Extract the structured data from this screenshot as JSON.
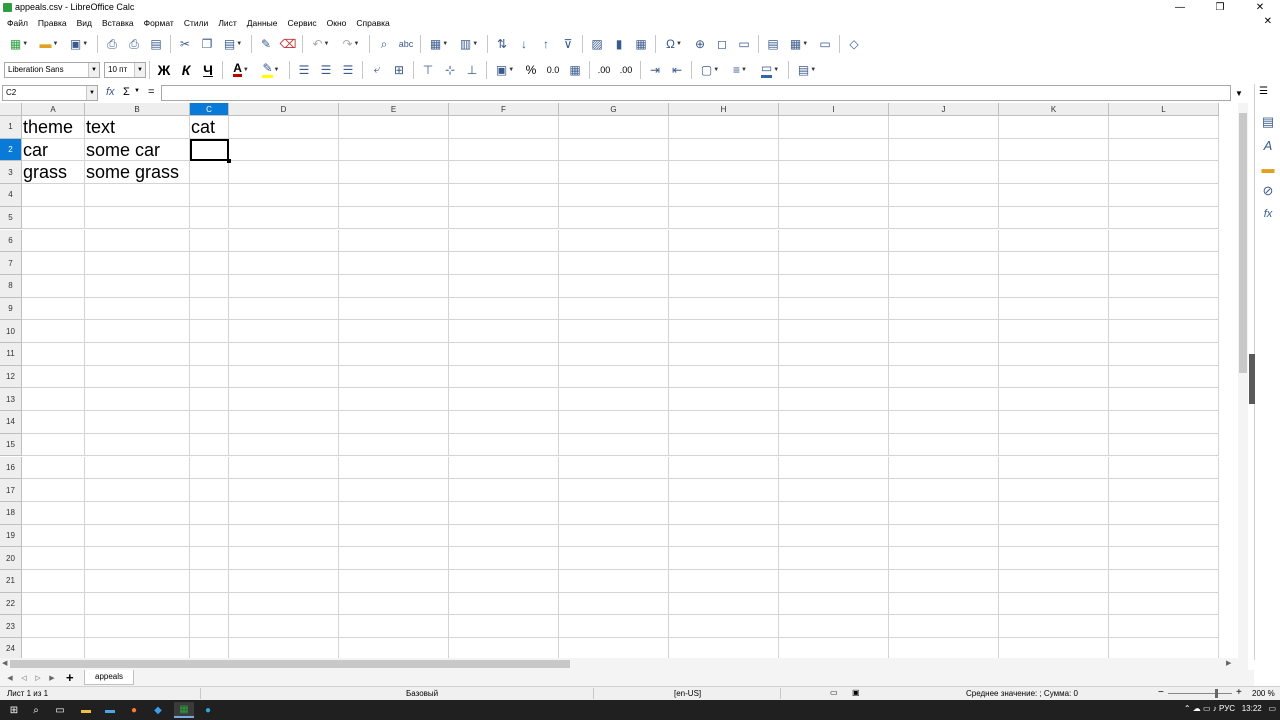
{
  "window": {
    "title": "appeals.csv - LibreOffice Calc",
    "minimize_label": "—",
    "restore_label": "❒",
    "close_label": "✕",
    "doc_close_label": "✕"
  },
  "menu": [
    "Файл",
    "Правка",
    "Вид",
    "Вставка",
    "Формат",
    "Стили",
    "Лист",
    "Данные",
    "Сервис",
    "Окно",
    "Справка"
  ],
  "format_toolbar": {
    "font_name": "Liberation Sans",
    "font_size": "10 пт",
    "bold_label": "Ж",
    "italic_label": "К",
    "underline_label": "Ч",
    "percent_label": "%",
    "number_label": "0.0",
    "add_decimal_label": ".00",
    "del_decimal_label": ".00"
  },
  "formula_bar": {
    "name_box": "C2",
    "fx_label": "fx",
    "sum_label": "Σ",
    "equals_label": "=",
    "value": ""
  },
  "columns": [
    "A",
    "B",
    "C",
    "D",
    "E",
    "F",
    "G",
    "H",
    "I",
    "J",
    "K",
    "L"
  ],
  "selected_column": "C",
  "row_numbers": [
    "1",
    "2",
    "3",
    "4",
    "5",
    "6",
    "7",
    "8",
    "9",
    "10",
    "11",
    "12",
    "13",
    "14",
    "15",
    "16",
    "17",
    "18",
    "19",
    "20",
    "21",
    "22",
    "23",
    "24"
  ],
  "selected_row": "2",
  "cells": {
    "A1": "theme",
    "B1": "text",
    "C1": "cat",
    "A2": "car",
    "B2": "some car",
    "C2": "",
    "A3": "grass",
    "B3": "some grass",
    "C3": ""
  },
  "sheet_tabs": [
    "appeals"
  ],
  "add_sheet_label": "+",
  "status": {
    "sheet_info": "Лист 1 из 1",
    "page_style": "Базовый",
    "language": "[en-US]",
    "summary": "Среднее значение: ; Сумма: 0",
    "zoom": "200 %",
    "zoom_level": 2.0
  },
  "taskbar": {
    "language": "РУС",
    "time": "13:22"
  },
  "colors": {
    "selection_header": "#0a7ad8",
    "app_green": "#2c9e3f",
    "taskbar": "#202020"
  }
}
